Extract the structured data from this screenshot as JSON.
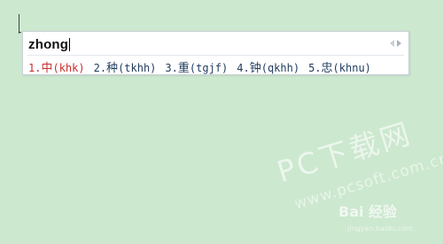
{
  "ime": {
    "composition": "zhong",
    "candidates": [
      {
        "index": "1.",
        "char": "中",
        "code": "(khk)"
      },
      {
        "index": "2.",
        "char": "种",
        "code": "(tkhh)"
      },
      {
        "index": "3.",
        "char": "重",
        "code": "(tgjf)"
      },
      {
        "index": "4.",
        "char": "钟",
        "code": "(qkhh)"
      },
      {
        "index": "5.",
        "char": "忠",
        "code": "(khnu)"
      }
    ],
    "pager": {
      "prev_icon": "triangle-left-icon",
      "next_icon": "triangle-right-icon"
    }
  },
  "watermark": {
    "main": "PC下载网",
    "url": "www.pcsoft.com.cn",
    "baidu": "Bai 经验",
    "baidu_url": "jingyan.baidu.com"
  },
  "colors": {
    "background": "#cce8cf",
    "selected_candidate": "#c82d2d",
    "candidate_text": "#1f3a5c"
  }
}
